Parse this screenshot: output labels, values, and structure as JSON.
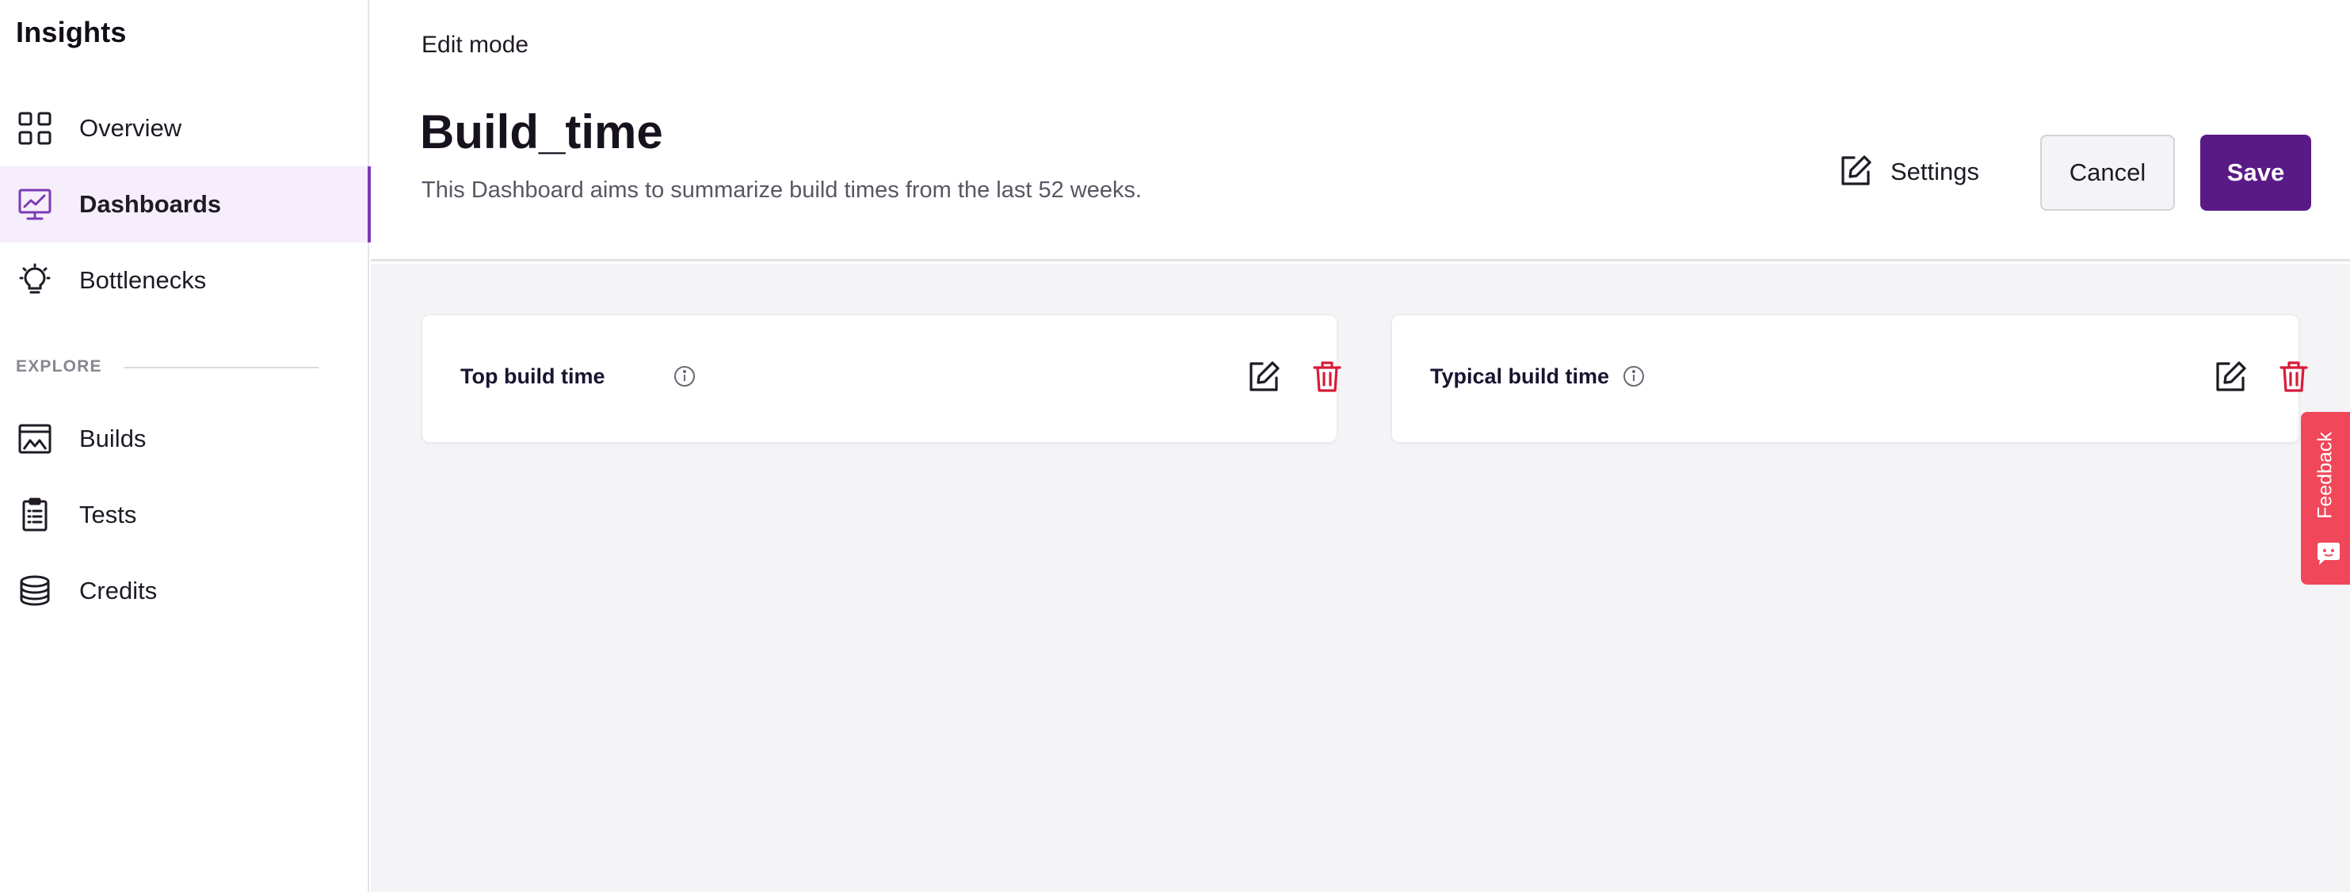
{
  "sidebar": {
    "brand": "Insights",
    "primary_items": [
      {
        "label": "Overview",
        "icon": "grid-icon"
      },
      {
        "label": "Dashboards",
        "icon": "chart-monitor-icon",
        "active": true
      },
      {
        "label": "Bottlenecks",
        "icon": "lightbulb-icon"
      }
    ],
    "section_label": "EXPLORE",
    "explore_items": [
      {
        "label": "Builds",
        "icon": "builds-icon"
      },
      {
        "label": "Tests",
        "icon": "clipboard-icon"
      },
      {
        "label": "Credits",
        "icon": "coins-stack-icon"
      }
    ]
  },
  "header": {
    "mode": "Edit mode",
    "title": "Build_time",
    "description": "This Dashboard aims to summarize build times from the last 52 weeks.",
    "settings_label": "Settings",
    "cancel_label": "Cancel",
    "save_label": "Save"
  },
  "cards": [
    {
      "title": "Top build time"
    },
    {
      "title": "Typical build time"
    }
  ],
  "feedback": {
    "label": "Feedback"
  },
  "colors": {
    "accent": "#5a1a86",
    "active_nav_bg": "#f6eefb",
    "active_indicator": "#7b3bb8",
    "delete": "#d81b3a",
    "feedback": "#f0475a",
    "canvas": "#f4f3f6"
  }
}
